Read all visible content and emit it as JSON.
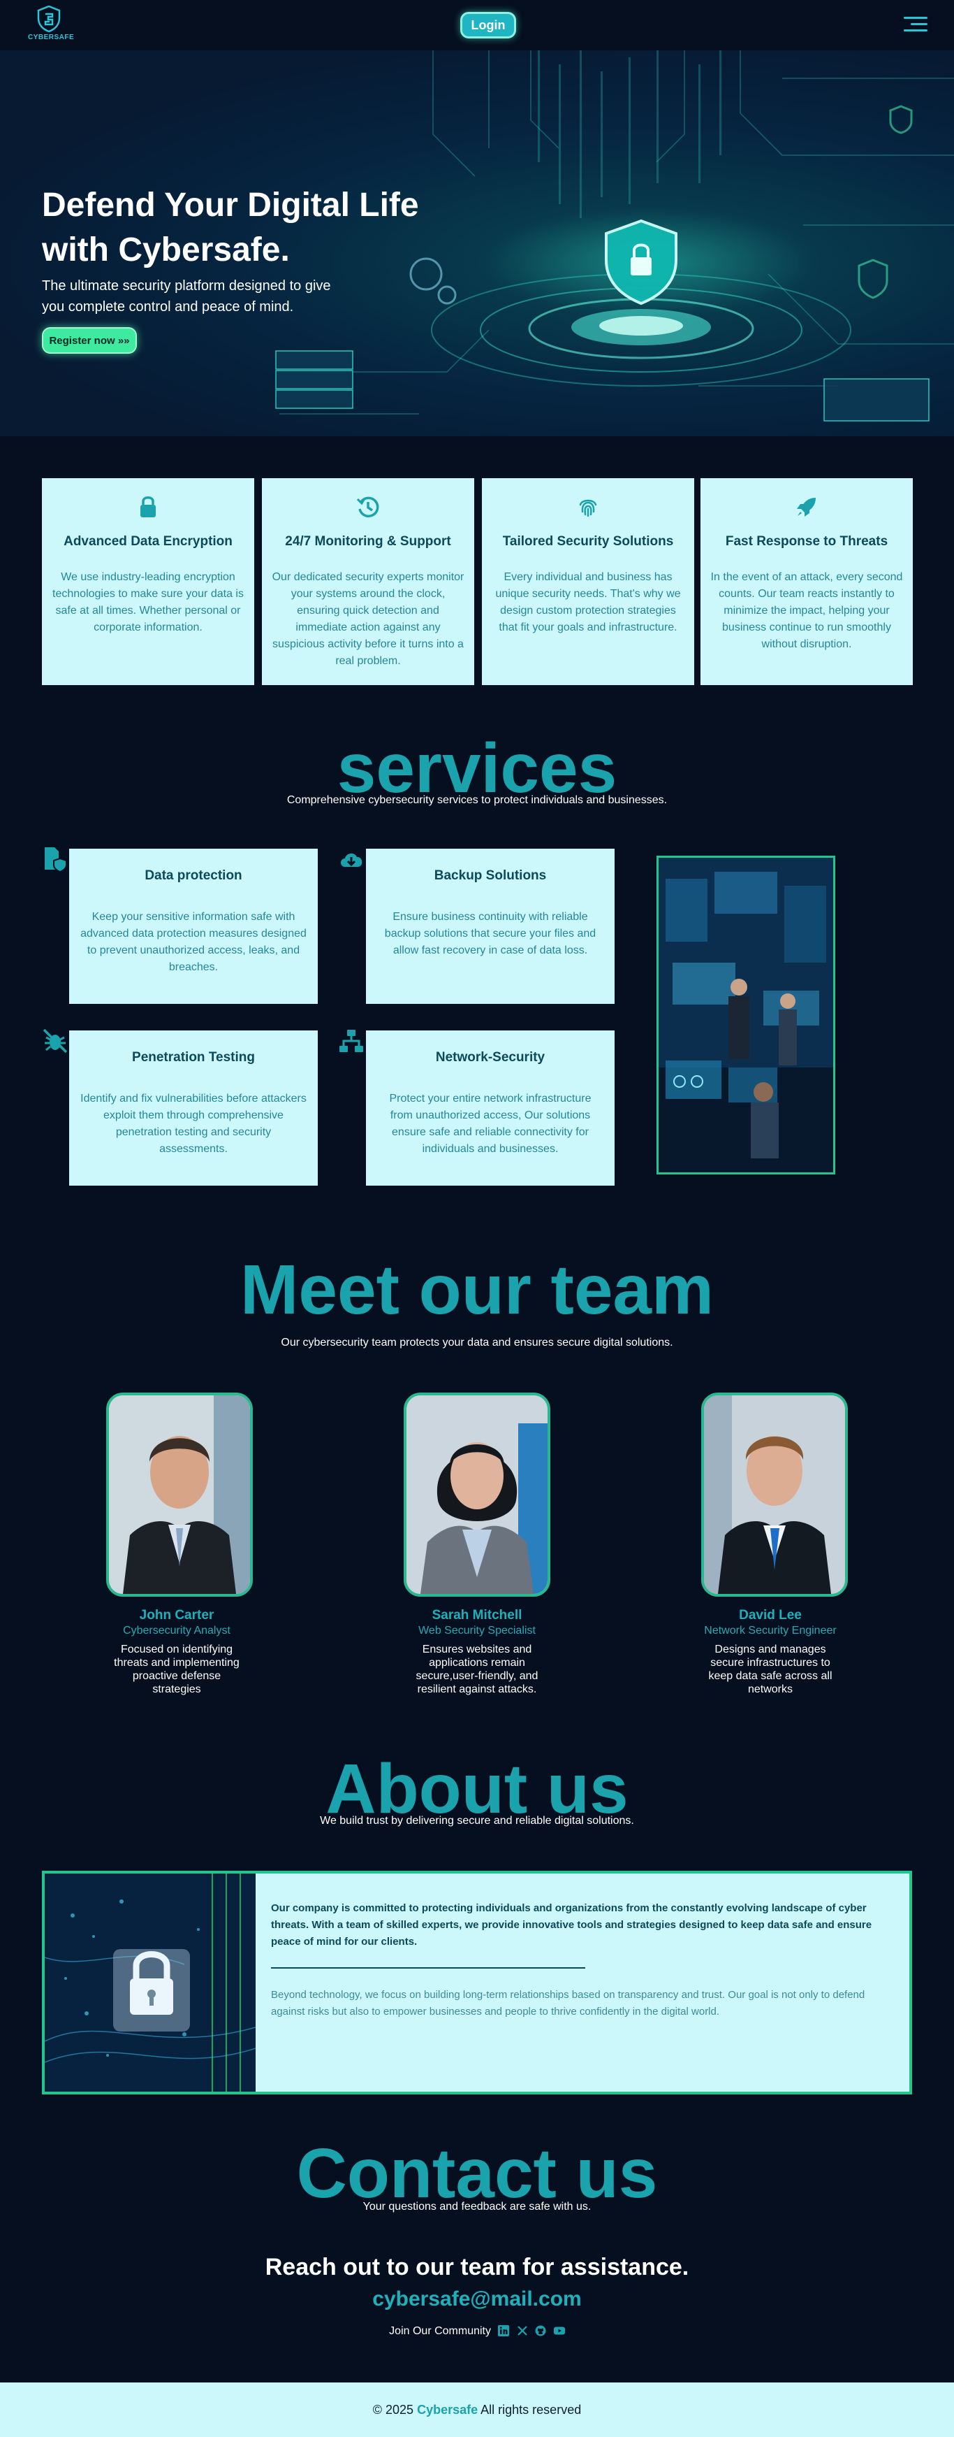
{
  "header": {
    "logo_text": "CYBERSAFE",
    "login_label": "Login"
  },
  "hero": {
    "title_line1": "Defend Your Digital Life",
    "title_line2": "with Cybersafe.",
    "subtitle": "The ultimate security platform designed to give you complete control and peace of mind.",
    "register_label": "Register now »»"
  },
  "features": [
    {
      "icon": "lock-icon",
      "title": "Advanced Data Encryption",
      "text": "We use industry-leading encryption technologies to make sure your data is safe at all times. Whether personal or corporate information."
    },
    {
      "icon": "history-icon",
      "title": "24/7 Monitoring & Support",
      "text": "Our dedicated security experts monitor your systems around the clock, ensuring quick detection and immediate action against any suspicious activity before it turns into a real problem."
    },
    {
      "icon": "fingerprint-icon",
      "title": "Tailored Security Solutions",
      "text": "Every individual and business has unique security needs. That's why we design custom protection strategies that fit your goals and infrastructure."
    },
    {
      "icon": "rocket-icon",
      "title": "Fast Response to Threats",
      "text": "In the event of an attack, every second counts. Our team reacts instantly to minimize the impact, helping your business continue to run smoothly without disruption."
    }
  ],
  "services": {
    "title": "services",
    "subtitle": "Comprehensive cybersecurity services to protect individuals and businesses.",
    "items": [
      {
        "icon": "file-shield-icon",
        "title": "Data protection",
        "text": "Keep your sensitive information safe with advanced data protection measures designed to prevent unauthorized access, leaks, and breaches."
      },
      {
        "icon": "cloud-download-icon",
        "title": "Backup Solutions",
        "text": "Ensure business continuity with reliable backup solutions that secure your files and allow fast recovery in case of data loss."
      },
      {
        "icon": "bug-slash-icon",
        "title": "Penetration Testing",
        "text": "Identify and fix vulnerabilities before attackers exploit them through comprehensive penetration testing and security assessments."
      },
      {
        "icon": "network-icon",
        "title": "Network-Security",
        "text": "Protect your entire network infrastructure from unauthorized access, Our solutions ensure safe and reliable connectivity for individuals and businesses."
      }
    ]
  },
  "team": {
    "title": "Meet our team",
    "subtitle": "Our cybersecurity team protects your data and ensures secure digital solutions.",
    "members": [
      {
        "name": "John Carter",
        "role": "Cybersecurity Analyst",
        "desc": "Focused on identifying threats and implementing proactive defense strategies"
      },
      {
        "name": "Sarah Mitchell",
        "role": "Web Security Specialist",
        "desc": "Ensures websites and applications remain secure,user-friendly, and resilient against attacks."
      },
      {
        "name": "David Lee",
        "role": "Network Security Engineer",
        "desc": "Designs and manages secure infrastructures to keep data safe across all networks"
      }
    ]
  },
  "about": {
    "title": "About us",
    "subtitle": "We build trust by delivering secure and reliable digital solutions.",
    "lead": "Our company is committed to protecting individuals and organizations from the constantly evolving landscape of cyber threats. With a team of skilled experts, we provide innovative tools and strategies designed to keep data safe and ensure peace of mind for our clients.",
    "text": "Beyond technology, we focus on building long-term relationships based on transparency and trust. Our goal is not only to defend against risks but also to empower businesses and people to thrive confidently in the digital world."
  },
  "contact": {
    "title": "Contact us",
    "subtitle": "Your questions and feedback are safe with us.",
    "reach": "Reach out to our team for assistance.",
    "email": "cybersafe@mail.com",
    "community": "Join Our Community"
  },
  "footer": {
    "prefix": "© 2025",
    "brand": "Cybersafe",
    "suffix": "All rights reserved"
  },
  "colors": {
    "background": "#050f1f",
    "accent": "#1aa3ad",
    "card": "#cdf8fb",
    "green": "#23c58c"
  }
}
